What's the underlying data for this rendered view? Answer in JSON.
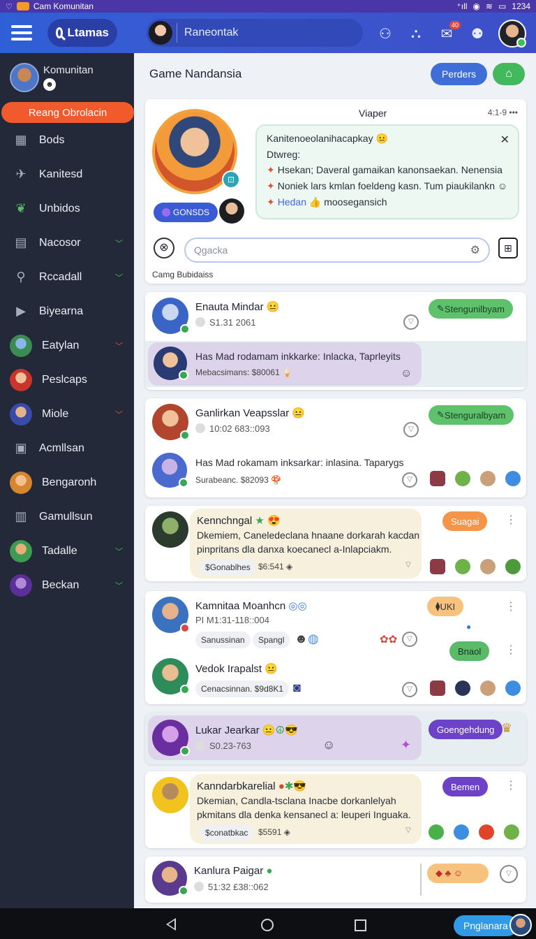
{
  "status_bar": {
    "app_title": "Cam Komunitan",
    "time": "1234"
  },
  "appbar": {
    "search_label": "Ltamas",
    "chat_placeholder": "Raneontak",
    "notif_count": "40"
  },
  "sidebar": {
    "profile_name": "Komunitan",
    "active_item": "Reang Obrolacin",
    "items": [
      {
        "label": "Bods",
        "icon": "grid-icon",
        "chevron": ""
      },
      {
        "label": "Kanitesd",
        "icon": "rocket-icon",
        "chevron": ""
      },
      {
        "label": "Unbidos",
        "icon": "leaf-icon",
        "chevron": ""
      },
      {
        "label": "Nacosor",
        "icon": "building-icon",
        "chevron": "v"
      },
      {
        "label": "Rccadall",
        "icon": "search-icon",
        "chevron": "v"
      },
      {
        "label": "Biyearna",
        "icon": "play-icon",
        "chevron": ""
      },
      {
        "label": "Eatylan",
        "icon": "avatar-icon",
        "chevron": "v"
      },
      {
        "label": "Peslcaps",
        "icon": "avatar-icon",
        "chevron": ""
      },
      {
        "label": "Miole",
        "icon": "avatar-icon",
        "chevron": "v"
      },
      {
        "label": "Acmllsan",
        "icon": "camera-icon",
        "chevron": ""
      },
      {
        "label": "Bengaronh",
        "icon": "avatar-icon",
        "chevron": ""
      },
      {
        "label": "Gamullsun",
        "icon": "trash-icon",
        "chevron": ""
      },
      {
        "label": "Tadalle",
        "icon": "avatar-icon",
        "chevron": "v"
      },
      {
        "label": "Beckan",
        "icon": "avatar-icon",
        "chevron": "v"
      }
    ]
  },
  "main": {
    "title": "Game Nandansia",
    "header_button": "Perders",
    "featured": {
      "name": "Viaper",
      "time": "4:1-9",
      "tag": "GONSDS",
      "bubble_title": "Kanitenoeolanihacapkay",
      "bubble_line2": "Dtwreg:",
      "bullets": [
        "Hsekan; Daveral gamaikan kanonsaekan. Nenensia",
        "Noniek lars kmlan foeldeng kasn. Tum piaukilankn",
        "Hedan"
      ],
      "bullet3_tail": "moosegansich",
      "search_placeholder": "Qgacka",
      "footer": "Camg Bubidaiss"
    },
    "chats": [
      {
        "name": "Enauta Mindar",
        "meta": "S1.31 2061",
        "pill": "Stengunilbyam",
        "sub_msg": "Has Mad rodamam inkkarke: Inlacka, Taprleyits",
        "sub_meta": "Mebacsimans: $80061"
      },
      {
        "name": "Ganlirkan Veapsslar",
        "meta": "10:02 683::093",
        "pill": "Stenguralbyam",
        "sub_msg": "Has Mad rokamam inksarkar: inlasina. Taparygs",
        "sub_meta": "Surabeanc. $82093"
      },
      {
        "name": "Kennchngal",
        "msg1": "Dkemiem, Caneledeclana hnaane dorkarah kacdan",
        "msg2": "pinpritans dla danxa koecanecl a-Inlapciakm.",
        "chip": "Gonablhes",
        "chip_meta": "$6:541",
        "pill": "Suagai"
      },
      {
        "name": "Kamnitaa Moanhcn",
        "meta": "PI M1:31-118::004",
        "chip1": "Sanussinan",
        "chip2": "Spangl",
        "pill": "UKI",
        "name2": "Vedok Irapalst",
        "meta2": "Cenacsinnan. $9d8K1",
        "pill2": "Bnaol"
      },
      {
        "name": "Lukar Jearkar",
        "meta": "S0.23-763",
        "pill": "Goengehdung"
      },
      {
        "name": "Kanndarbkarelial",
        "msg1": "Dkemian, Candla-tsclana Inacbe dorkanlelyah",
        "msg2": "pkmitans dla denka kensanecl a: leuperi Inguaka.",
        "chip": "conatbkac",
        "chip_meta": "$5591",
        "pill": "Bemen"
      },
      {
        "name": "Kanlura Paigar",
        "meta": "51:32 £38::062"
      }
    ]
  },
  "navbar": {
    "cta": "Pnglanara"
  }
}
